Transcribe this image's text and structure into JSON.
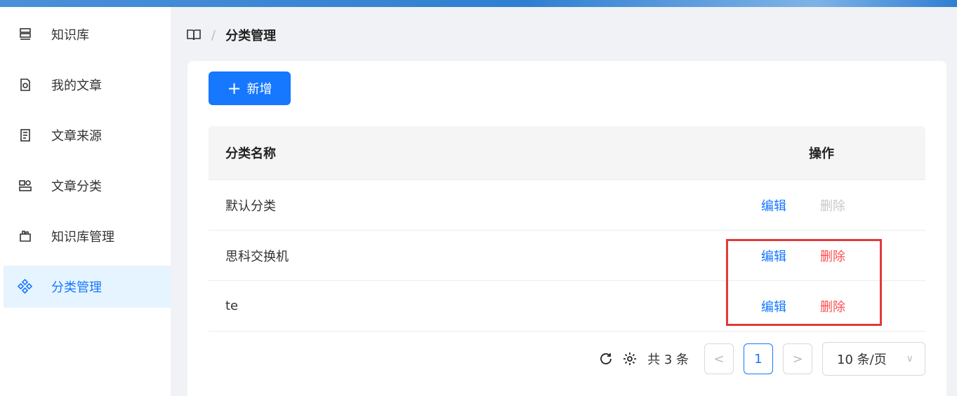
{
  "sidebar": {
    "items": [
      {
        "label": "知识库",
        "icon": "library-icon",
        "active": false
      },
      {
        "label": "我的文章",
        "icon": "my-articles-icon",
        "active": false
      },
      {
        "label": "文章来源",
        "icon": "article-source-icon",
        "active": false
      },
      {
        "label": "文章分类",
        "icon": "article-category-icon",
        "active": false
      },
      {
        "label": "知识库管理",
        "icon": "library-manage-icon",
        "active": false
      },
      {
        "label": "分类管理",
        "icon": "category-manage-icon",
        "active": true
      }
    ]
  },
  "breadcrumb": {
    "separator": "/",
    "current": "分类管理"
  },
  "toolbar": {
    "add_label": "新增"
  },
  "table": {
    "columns": [
      "分类名称",
      "操作"
    ],
    "rows": [
      {
        "name": "默认分类",
        "edit": "编辑",
        "delete": "删除",
        "delete_disabled": true
      },
      {
        "name": "思科交换机",
        "edit": "编辑",
        "delete": "删除",
        "delete_disabled": false
      },
      {
        "name": "te",
        "edit": "编辑",
        "delete": "删除",
        "delete_disabled": false
      }
    ]
  },
  "pagination": {
    "total_text": "共 3 条",
    "current_page": "1",
    "prev": "<",
    "next": ">",
    "page_size": "10 条/页"
  },
  "colors": {
    "primary": "#1677ff",
    "danger": "#ff4d4f",
    "highlight_box": "#e23a3a"
  }
}
